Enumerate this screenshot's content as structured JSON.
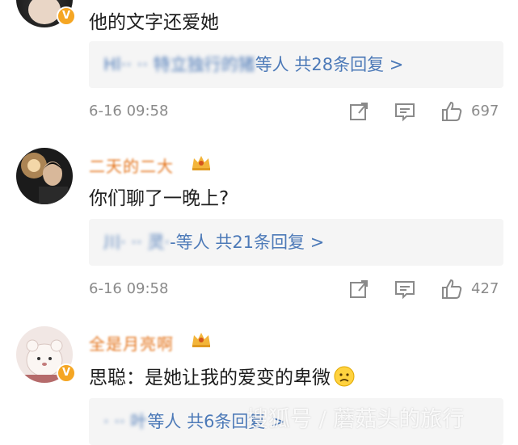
{
  "comments": [
    {
      "name": "",
      "text": "他的文字还爱她",
      "replies_names": "Hl··  ·· 特立独行的猪",
      "replies_suffix": "等人 共28条回复 >",
      "time": "6-16 09:58",
      "likes": "697"
    },
    {
      "name": "二天的二大",
      "text": "你们聊了一晚上?",
      "replies_names": "川·  ·· 灵·",
      "replies_suffix": "-等人 共21条回复 >",
      "time": "6-16 09:58",
      "likes": "427"
    },
    {
      "name": "全是月亮啊",
      "text": "思聪：是她让我的爱变的卑微",
      "replies_names": "·  ·· 叶",
      "replies_suffix": "等人 共6条回复 >",
      "time": "",
      "likes": ""
    }
  ],
  "watermark": "搜狐号 / 蘑菇头的旅行",
  "icons": [
    "repost-icon",
    "comment-icon",
    "like-icon",
    "verified-badge-icon",
    "crown-icon",
    "sad-smiley-icon"
  ],
  "colors": {
    "name": "#e4761f",
    "reply_link": "#4d7ab8",
    "reply_bg": "#f5f5f5",
    "meta": "#8a8a8a",
    "badge": "#f5a623"
  }
}
